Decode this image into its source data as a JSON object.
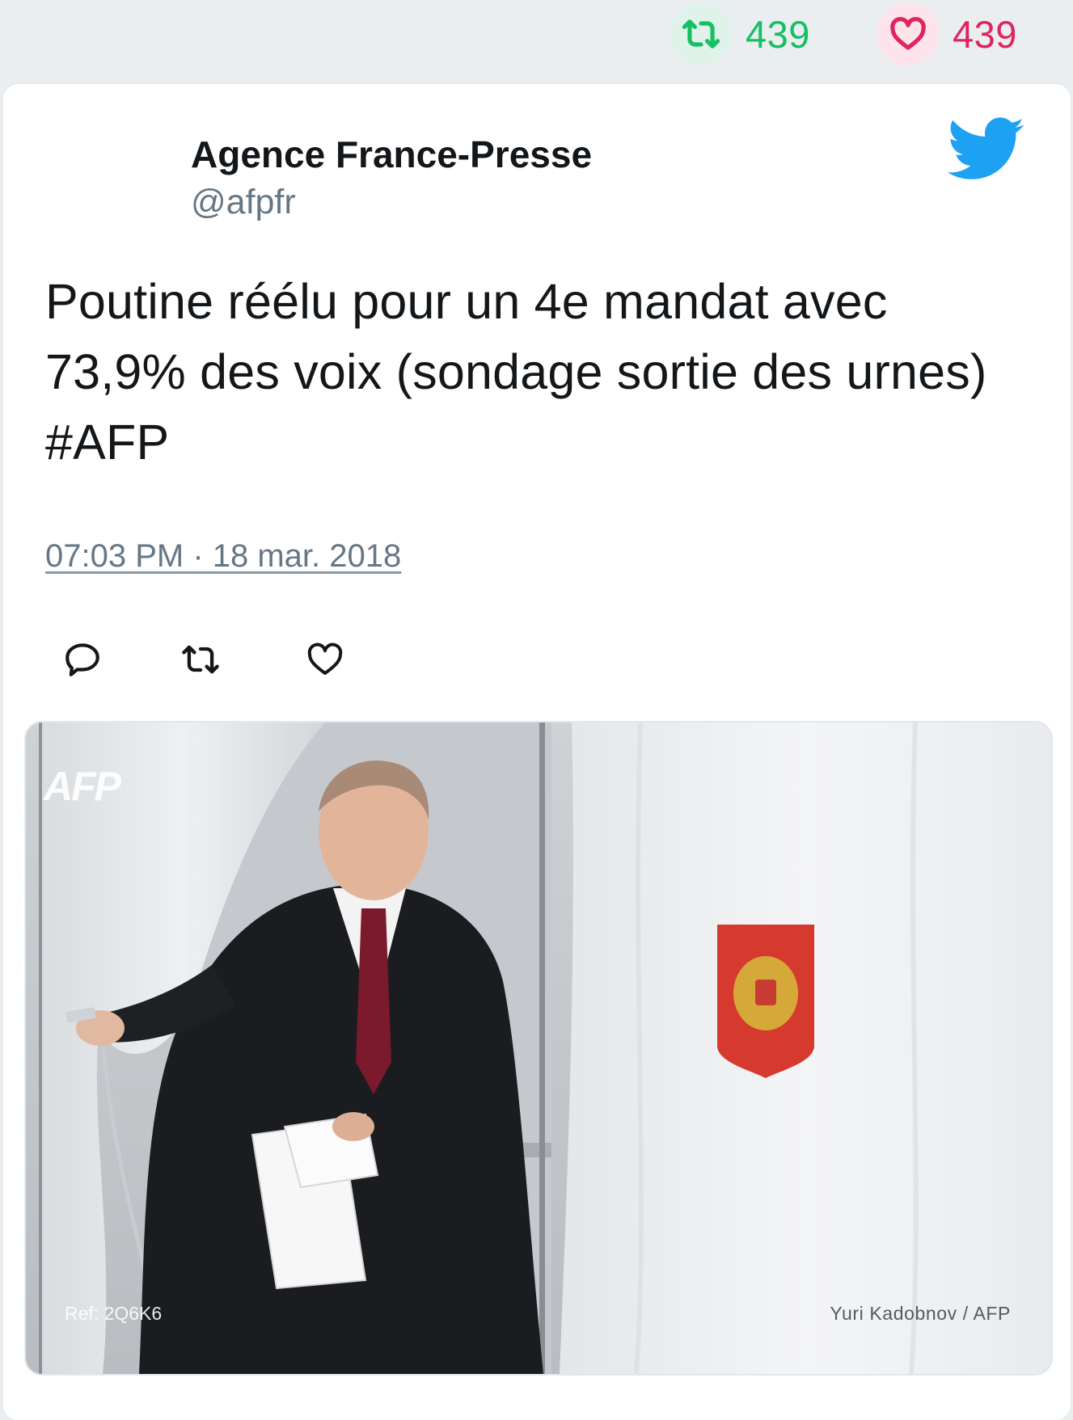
{
  "stats": {
    "retweets": "439",
    "likes": "439"
  },
  "author": {
    "name": "Agence France-Presse",
    "handle": "@afpfr"
  },
  "tweet": {
    "text": "Poutine réélu pour un 4e mandat avec 73,9% des voix (sondage sortie des urnes) #AFP",
    "timestamp": "07:03 PM · 18 mar. 2018"
  },
  "media": {
    "watermark": "AFP",
    "ref": "Ref: 2Q6K6",
    "credit": "Yuri Kadobnov / AFP"
  },
  "icons": {
    "retweet": "retweet-icon",
    "like": "heart-icon",
    "reply": "reply-icon",
    "brand": "twitter-bird-icon"
  },
  "colors": {
    "retweet_green": "#17bf63",
    "like_pink": "#e0245e",
    "twitter_blue": "#1da1f2",
    "muted_text": "#657786"
  }
}
